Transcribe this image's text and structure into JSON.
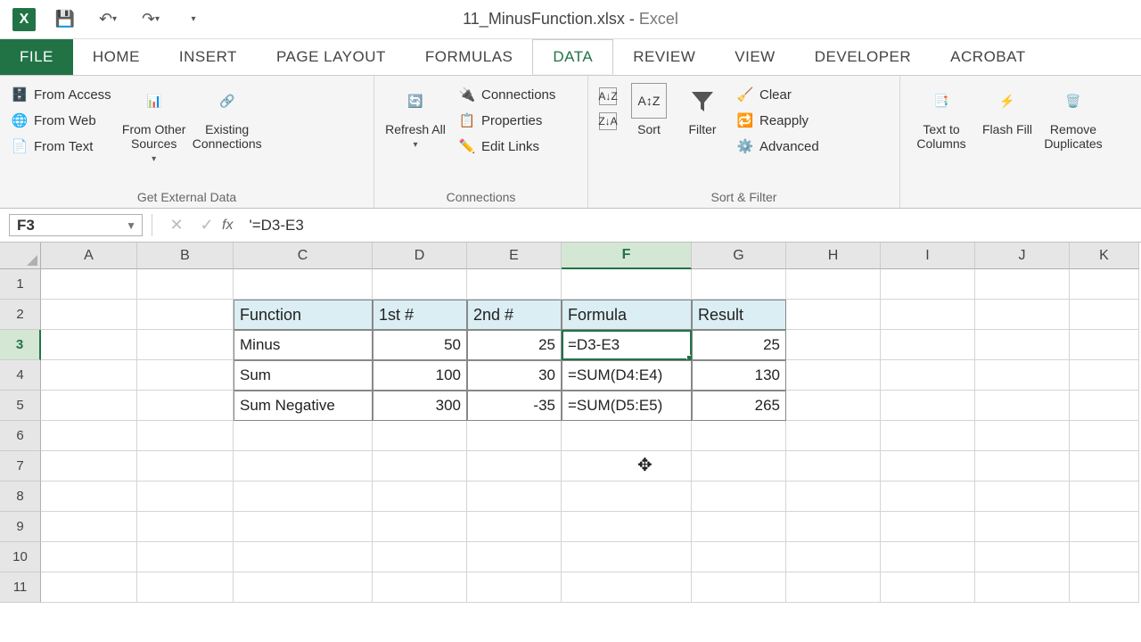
{
  "title": {
    "filename": "11_MinusFunction.xlsx",
    "app": "Excel"
  },
  "qat": {
    "save": "💾",
    "undo": "↶",
    "redo": "↷",
    "custom": "▾"
  },
  "tabs": {
    "file": "FILE",
    "home": "HOME",
    "insert": "INSERT",
    "page_layout": "PAGE LAYOUT",
    "formulas": "FORMULAS",
    "data": "DATA",
    "review": "REVIEW",
    "view": "VIEW",
    "developer": "DEVELOPER",
    "acrobat": "ACROBAT"
  },
  "ribbon": {
    "get_external": {
      "label": "Get External Data",
      "access": "From Access",
      "web": "From Web",
      "text": "From Text",
      "other": "From Other Sources",
      "existing": "Existing Connections"
    },
    "connections": {
      "label": "Connections",
      "refresh": "Refresh All",
      "conn": "Connections",
      "prop": "Properties",
      "edit": "Edit Links"
    },
    "sort_filter": {
      "label": "Sort & Filter",
      "sort": "Sort",
      "filter": "Filter",
      "clear": "Clear",
      "reapply": "Reapply",
      "advanced": "Advanced"
    },
    "data_tools": {
      "label": "",
      "ttc": "Text to Columns",
      "flash": "Flash Fill",
      "remove": "Remove Duplicates"
    }
  },
  "formula_bar": {
    "name_box": "F3",
    "formula": "'=D3-E3"
  },
  "columns": [
    "A",
    "B",
    "C",
    "D",
    "E",
    "F",
    "G",
    "H",
    "I",
    "J",
    "K"
  ],
  "row_numbers": [
    "1",
    "2",
    "3",
    "4",
    "5",
    "6",
    "7",
    "8",
    "9",
    "10",
    "11"
  ],
  "table": {
    "headers": {
      "c": "Function",
      "d": "1st #",
      "e": "2nd #",
      "f": "Formula",
      "g": "Result"
    },
    "r3": {
      "c": "Minus",
      "d": "50",
      "e": "25",
      "f": "=D3-E3",
      "g": "25"
    },
    "r4": {
      "c": "Sum",
      "d": "100",
      "e": "30",
      "f": "=SUM(D4:E4)",
      "g": "130"
    },
    "r5": {
      "c": "Sum Negative",
      "d": "300",
      "e": "-35",
      "f": "=SUM(D5:E5)",
      "g": "265"
    }
  }
}
